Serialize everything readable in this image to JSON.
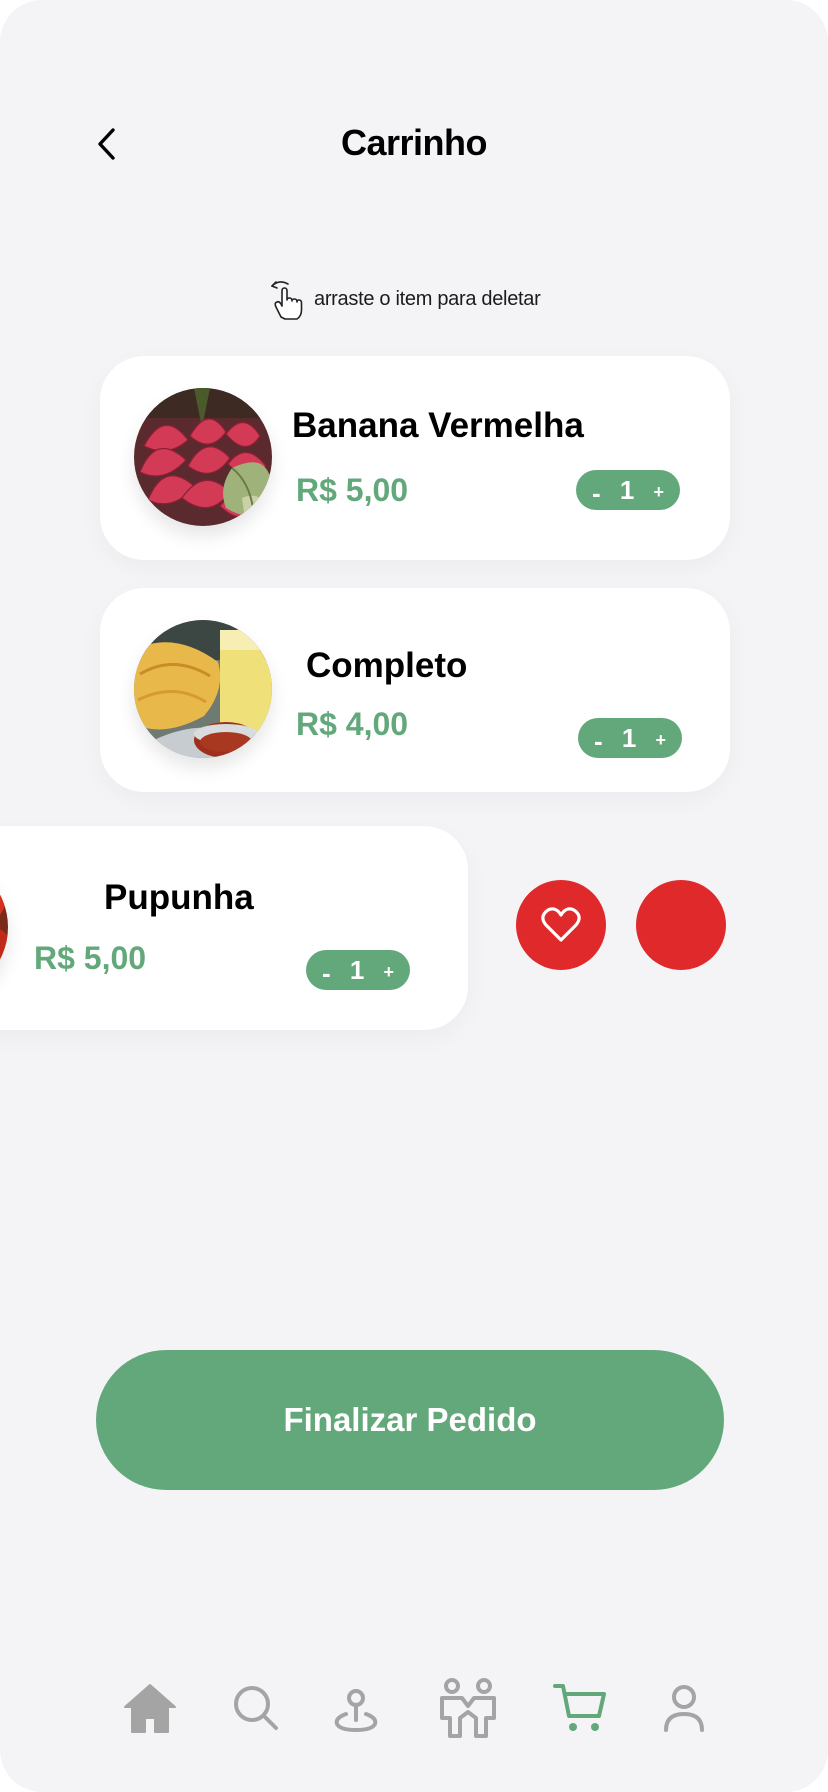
{
  "header": {
    "title": "Carrinho"
  },
  "hint": {
    "text": "arraste o item para deletar"
  },
  "cart": {
    "items": [
      {
        "name": "Banana Vermelha",
        "price": "R$ 5,00",
        "quantity": "1",
        "minus": "-",
        "plus": "+"
      },
      {
        "name": "Completo",
        "price": "R$ 4,00",
        "quantity": "1",
        "minus": "-",
        "plus": "+"
      },
      {
        "name": "Pupunha",
        "price": "R$ 5,00",
        "quantity": "1",
        "minus": "-",
        "plus": "+"
      }
    ]
  },
  "swipe_actions": {
    "favorite_icon": "heart-icon",
    "delete_icon": "none"
  },
  "checkout": {
    "label": "Finalizar Pedido"
  },
  "bottom_nav": {
    "items": [
      {
        "icon": "home-icon",
        "active": false
      },
      {
        "icon": "search-icon",
        "active": false
      },
      {
        "icon": "location-pin-icon",
        "active": false
      },
      {
        "icon": "people-icon",
        "active": false
      },
      {
        "icon": "cart-icon",
        "active": true
      },
      {
        "icon": "user-icon",
        "active": false
      }
    ]
  },
  "colors": {
    "background": "#f4f4f7",
    "card": "#ffffff",
    "accent_green": "#62a87a",
    "danger_red": "#e0292b",
    "nav_inactive": "#a4a4a4"
  }
}
